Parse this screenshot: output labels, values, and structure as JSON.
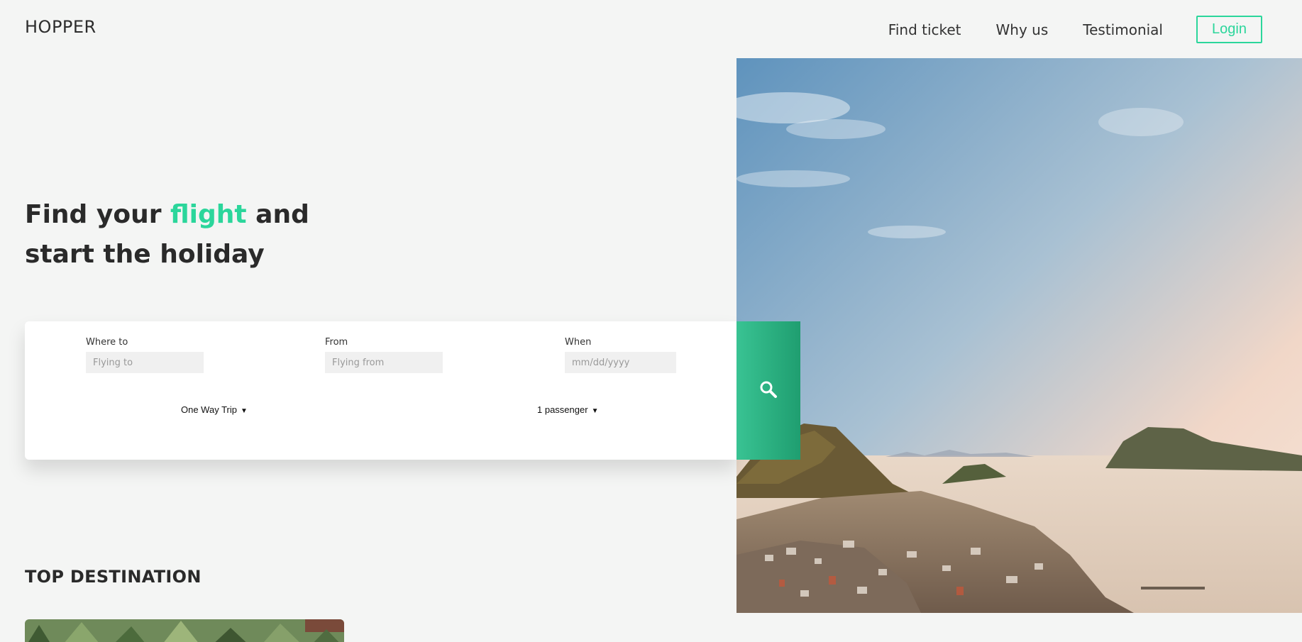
{
  "brand": {
    "logo": "HOPPER",
    "accent_color": "#2bd69b"
  },
  "nav": {
    "links": [
      "Find ticket",
      "Why us",
      "Testimonial"
    ],
    "login_label": "Login"
  },
  "hero": {
    "headline_pre": "Find your ",
    "headline_accent": "flight",
    "headline_post": " and start the holiday",
    "image": "coastal-town-sunset-photo"
  },
  "search": {
    "where_to": {
      "label": "Where to",
      "placeholder": "Flying to"
    },
    "from": {
      "label": "From",
      "placeholder": "Flying from"
    },
    "when": {
      "label": "When",
      "placeholder": "mm/dd/yyyy"
    },
    "trip_type": "One Way Trip",
    "passengers": "1 passenger",
    "button_icon": "search-icon"
  },
  "top_destination": {
    "title": "TOP DESTINATION",
    "card_image": "tropical-plants-photo"
  }
}
